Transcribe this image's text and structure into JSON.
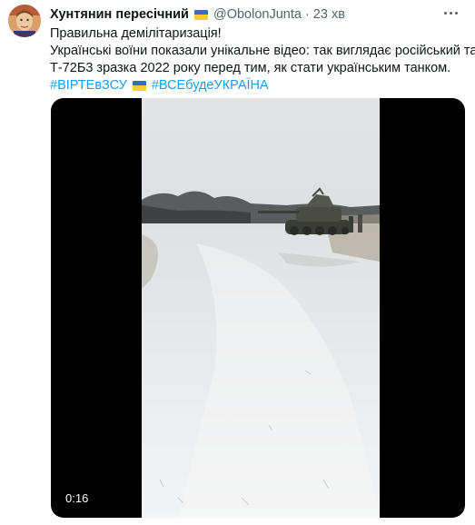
{
  "author": {
    "display_name": "Хунтянин пересічний",
    "handle": "@ObolonJunta",
    "separator": "·",
    "time": "23 хв"
  },
  "tweet": {
    "line1": "Правильна демілітаризація!",
    "line2": "Українські воїни показали унікальне відео: так виглядає російський танк",
    "line3": "Т-72Б3 зразка 2022 року перед тим, як стати українським танком.",
    "hashtag1": "#ВІРТЕвЗСУ",
    "hashtag2": "#ВСЕбудеУКРАЇНА"
  },
  "media": {
    "duration": "0:16"
  },
  "icons": {
    "avatar": "avatar",
    "flag": "ukraine-flag-icon",
    "more": "more-icon"
  },
  "colors": {
    "link": "#1d9bf0",
    "muted": "#536471",
    "text": "#0f1419"
  }
}
